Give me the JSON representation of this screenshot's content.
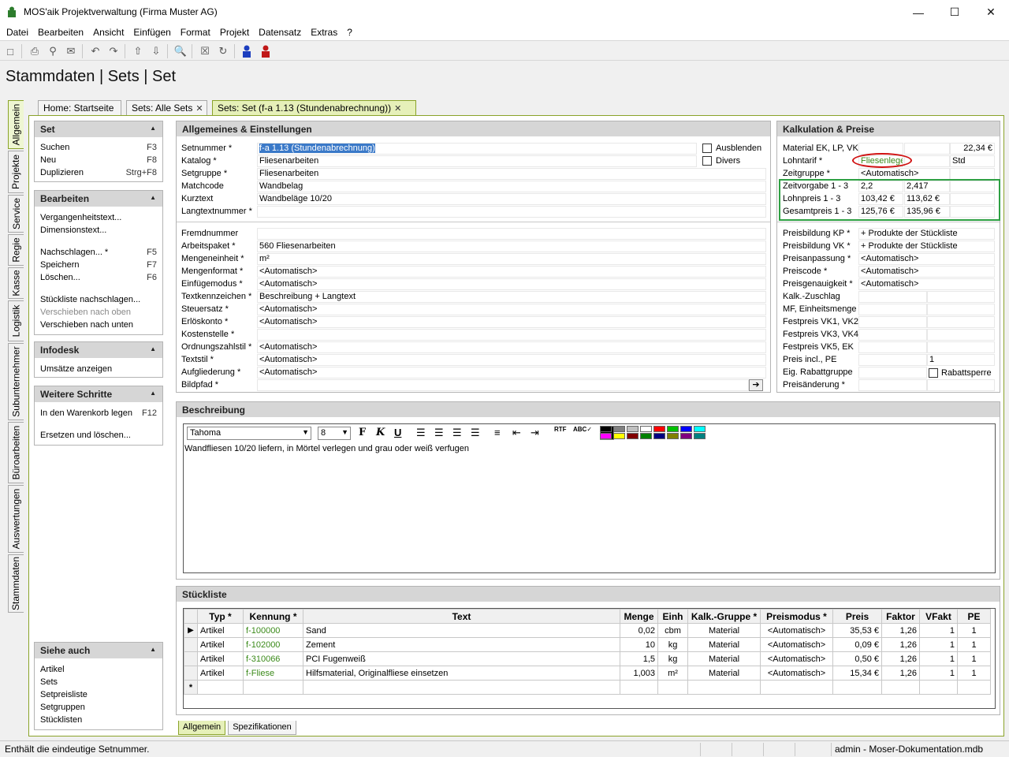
{
  "window": {
    "title": "MOS'aik Projektverwaltung (Firma Muster AG)"
  },
  "menu": [
    "Datei",
    "Bearbeiten",
    "Ansicht",
    "Einfügen",
    "Format",
    "Projekt",
    "Datensatz",
    "Extras",
    "?"
  ],
  "page_title": "Stammdaten | Sets | Set",
  "vertical_tabs": [
    "Allgemein",
    "Projekte",
    "Service",
    "Regie",
    "Kasse",
    "Logistik",
    "Subunternehmer",
    "Büroarbeiten",
    "Auswertungen",
    "Stammdaten"
  ],
  "doc_tabs": [
    "Home: Startseite",
    "Sets: Alle Sets",
    "Sets: Set (f-a 1.13 (Stundenabrechnung))"
  ],
  "side": {
    "set": {
      "title": "Set",
      "items": [
        {
          "label": "Suchen",
          "key": "F3"
        },
        {
          "label": "Neu",
          "key": "F8"
        },
        {
          "label": "Duplizieren",
          "key": "Strg+F8"
        }
      ]
    },
    "bearbeiten": {
      "title": "Bearbeiten",
      "items": [
        {
          "label": "Vergangenheitstext...",
          "key": ""
        },
        {
          "label": "Dimensionstext...",
          "key": ""
        },
        {
          "label": "Nachschlagen... *",
          "key": "F5"
        },
        {
          "label": "Speichern",
          "key": "F7"
        },
        {
          "label": "Löschen...",
          "key": "F6"
        },
        {
          "label": "Stückliste nachschlagen...",
          "key": ""
        },
        {
          "label": "Verschieben nach oben",
          "key": ""
        },
        {
          "label": "Verschieben nach unten",
          "key": ""
        }
      ]
    },
    "infodesk": {
      "title": "Infodesk",
      "items": [
        {
          "label": "Umsätze anzeigen",
          "key": ""
        }
      ]
    },
    "weitere": {
      "title": "Weitere Schritte",
      "items": [
        {
          "label": "In den Warenkorb legen",
          "key": "F12"
        },
        {
          "label": "Ersetzen und löschen...",
          "key": ""
        }
      ]
    },
    "siehe": {
      "title": "Siehe auch",
      "items": [
        {
          "label": "Artikel"
        },
        {
          "label": "Sets"
        },
        {
          "label": "Setpreisliste"
        },
        {
          "label": "Setgruppen"
        },
        {
          "label": "Stücklisten"
        }
      ]
    }
  },
  "allgemein": {
    "title": "Allgemeines & Einstellungen",
    "fields1": [
      {
        "label": "Setnummer *",
        "value": "f-a 1.13 (Stundenabrechnung)"
      },
      {
        "label": "Katalog *",
        "value": "Fliesenarbeiten"
      },
      {
        "label": "Setgruppe *",
        "value": "Fliesenarbeiten"
      },
      {
        "label": "Matchcode",
        "value": "Wandbelag"
      },
      {
        "label": "Kurztext",
        "value": "Wandbeläge 10/20"
      },
      {
        "label": "Langtextnummer *",
        "value": ""
      }
    ],
    "checks": [
      "Ausblenden",
      "Divers"
    ],
    "fields2": [
      {
        "label": "Fremdnummer",
        "value": ""
      },
      {
        "label": "Arbeitspaket *",
        "value": "560 Fliesenarbeiten"
      },
      {
        "label": "Mengeneinheit *",
        "value": "m²"
      },
      {
        "label": "Mengenformat *",
        "value": "<Automatisch>"
      },
      {
        "label": "Einfügemodus *",
        "value": "<Automatisch>"
      },
      {
        "label": "Textkennzeichen *",
        "value": "Beschreibung + Langtext"
      },
      {
        "label": "Steuersatz *",
        "value": "<Automatisch>"
      },
      {
        "label": "Erlöskonto *",
        "value": "<Automatisch>"
      },
      {
        "label": "Kostenstelle *",
        "value": ""
      },
      {
        "label": "Ordnungszahlstil *",
        "value": "<Automatisch>"
      },
      {
        "label": "Textstil *",
        "value": "<Automatisch>"
      },
      {
        "label": "Aufgliederung *",
        "value": "<Automatisch>"
      },
      {
        "label": "Bildpfad *",
        "value": ""
      }
    ]
  },
  "kalkulation": {
    "title": "Kalkulation & Preise",
    "rows1": [
      {
        "label": "Material EK, LP, VK",
        "v1": "",
        "v2": "",
        "v3": "22,34 €"
      },
      {
        "label": "Lohntarif *",
        "v1": "Fliesenleger",
        "v2": "",
        "v3": "Std"
      },
      {
        "label": "Zeitgruppe *",
        "v1": "<Automatisch>",
        "v2": "",
        "v3": ""
      },
      {
        "label": "Zeitvorgabe 1 - 3",
        "v1": "2,2",
        "v2": "2,417",
        "v3": ""
      },
      {
        "label": "Lohnpreis 1 - 3",
        "v1": "103,42 €",
        "v2": "113,62 €",
        "v3": ""
      },
      {
        "label": "Gesamtpreis 1 - 3",
        "v1": "125,76 €",
        "v2": "135,96 €",
        "v3": ""
      }
    ],
    "rows2": [
      {
        "label": "Preisbildung KP *",
        "v1": "+ Produkte der Stückliste",
        "v2": ""
      },
      {
        "label": "Preisbildung VK *",
        "v1": "+ Produkte der Stückliste",
        "v2": ""
      },
      {
        "label": "Preisanpassung *",
        "v1": "<Automatisch>",
        "v2": ""
      },
      {
        "label": "Preiscode *",
        "v1": "<Automatisch>",
        "v2": ""
      },
      {
        "label": "Preisgenauigkeit *",
        "v1": "<Automatisch>",
        "v2": ""
      },
      {
        "label": "Kalk.-Zuschlag",
        "v1": "",
        "v2": ""
      },
      {
        "label": "MF, Einheitsmenge",
        "v1": "",
        "v2": ""
      },
      {
        "label": "Festpreis VK1, VK2",
        "v1": "",
        "v2": ""
      },
      {
        "label": "Festpreis VK3, VK4",
        "v1": "",
        "v2": ""
      },
      {
        "label": "Festpreis VK5, EK",
        "v1": "",
        "v2": ""
      },
      {
        "label": "Preis incl., PE",
        "v1": "",
        "v2": "1"
      },
      {
        "label": "Eig. Rabattgruppe",
        "v1": "",
        "v2": "Rabattsperre"
      },
      {
        "label": "Preisänderung *",
        "v1": "",
        "v2": ""
      }
    ]
  },
  "beschreibung": {
    "title": "Beschreibung",
    "font": "Tahoma",
    "size": "8",
    "text": "Wandfliesen 10/20 liefern, in Mörtel verlegen und grau oder weiß verfugen",
    "palette": [
      "#000000",
      "#808080",
      "#c0c0c0",
      "#ffffff",
      "#ff0000",
      "#00c000",
      "#0000ff",
      "#00ffff",
      "#ff00ff",
      "#ffff00",
      "#800000",
      "#008000",
      "#000080",
      "#808000",
      "#800080",
      "#008080"
    ]
  },
  "stueckliste": {
    "title": "Stückliste",
    "columns": [
      "Typ *",
      "Kennung *",
      "Text",
      "Menge",
      "Einh",
      "Kalk.-Gruppe *",
      "Preismodus *",
      "Preis",
      "Faktor",
      "VFakt",
      "PE"
    ],
    "rows": [
      [
        "Artikel",
        "f-100000",
        "Sand",
        "0,02",
        "cbm",
        "Material",
        "<Automatisch>",
        "35,53 €",
        "1,26",
        "1",
        "1"
      ],
      [
        "Artikel",
        "f-102000",
        "Zement",
        "10",
        "kg",
        "Material",
        "<Automatisch>",
        "0,09 €",
        "1,26",
        "1",
        "1"
      ],
      [
        "Artikel",
        "f-310066",
        "PCI Fugenweiß",
        "1,5",
        "kg",
        "Material",
        "<Automatisch>",
        "0,50 €",
        "1,26",
        "1",
        "1"
      ],
      [
        "Artikel",
        "f-Fliese",
        "Hilfsmaterial, Originalfliese einsetzen",
        "1,003",
        "m²",
        "Material",
        "<Automatisch>",
        "15,34 €",
        "1,26",
        "1",
        "1"
      ]
    ]
  },
  "bottom_tabs": [
    "Allgemein",
    "Spezifikationen"
  ],
  "status": {
    "message": "Enthält die eindeutige Setnummer.",
    "user": "admin - Moser-Dokumentation.mdb"
  },
  "colors": {
    "accent": "#8aa32a",
    "selection": "#3a79c8",
    "highlight_box": "#2ea043",
    "circle": "#d01010"
  }
}
